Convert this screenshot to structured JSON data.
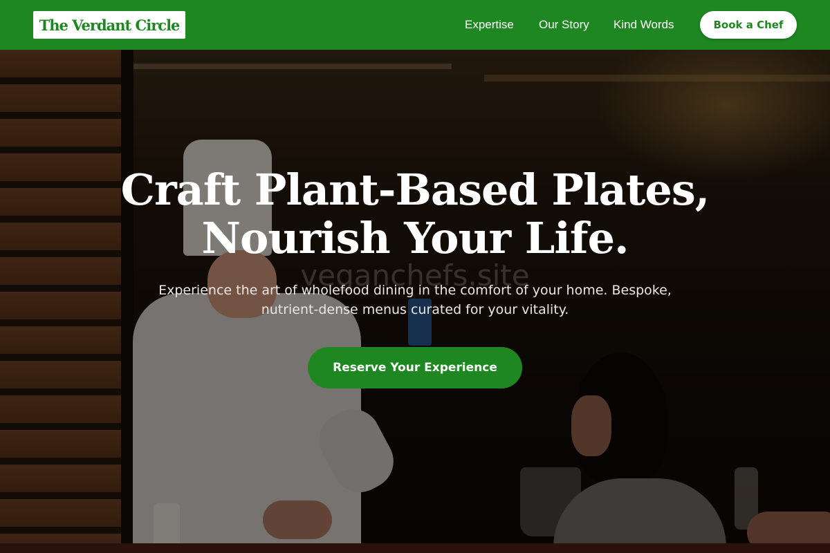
{
  "header": {
    "logo_text": "The Verdant Circle",
    "nav": [
      {
        "label": "Expertise"
      },
      {
        "label": "Our Story"
      },
      {
        "label": "Kind Words"
      }
    ],
    "cta_label": "Book a Chef"
  },
  "hero": {
    "headline_line1": "Craft Plant-Based Plates,",
    "headline_line2": "Nourish Your Life.",
    "watermark": "veganchefs.site",
    "subtext": "Experience the art of wholefood dining in the comfort of your home. Bespoke, nutrient-dense menus curated for your vitality.",
    "cta_label": "Reserve Your Experience",
    "background_image": "chef-serving-diner-photo"
  },
  "colors": {
    "brand_green": "#1e8722",
    "header_background": "#1e8722",
    "button_light_background": "#ffffff",
    "hero_text": "#ffffff"
  }
}
